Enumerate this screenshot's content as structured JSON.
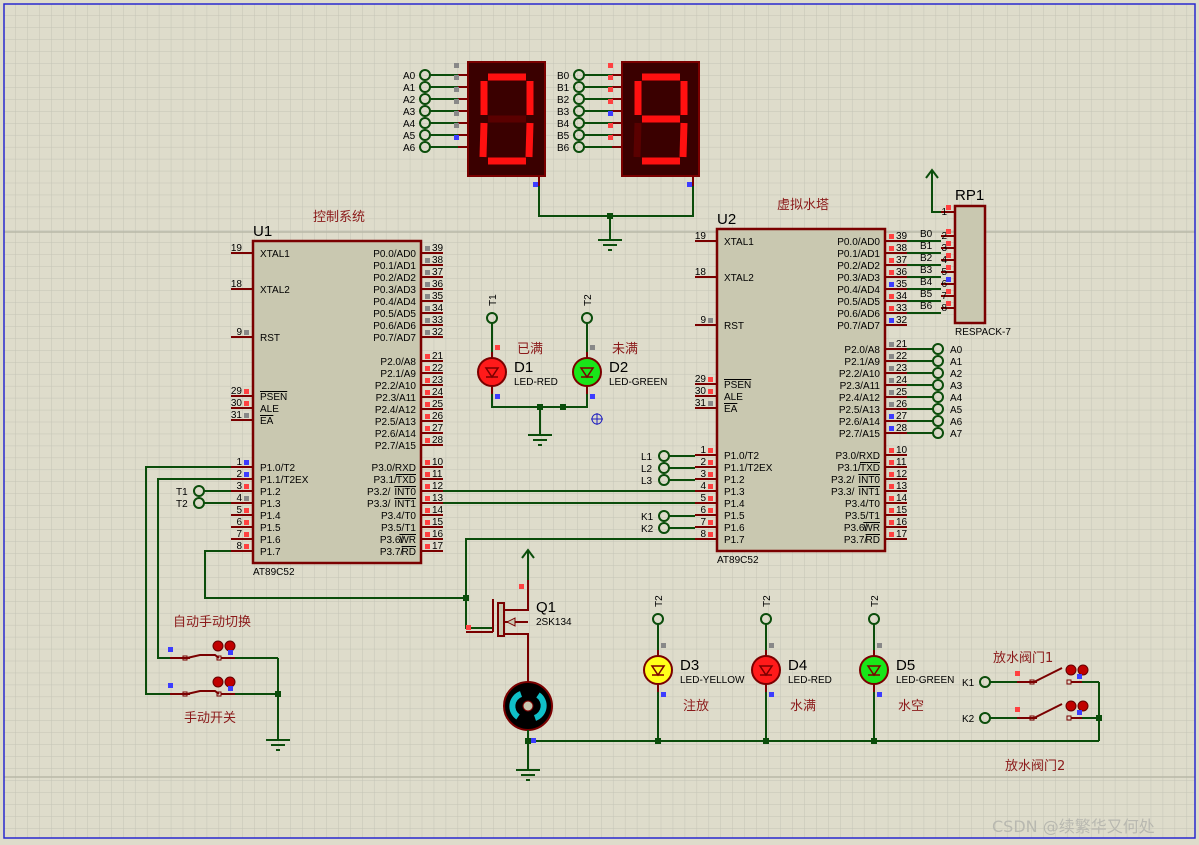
{
  "colors": {
    "wire": "#0b4d0b",
    "component": "#7a0000",
    "chip_fill": "#c9c8b0",
    "high": "#ff4040",
    "low": "#3c3cff",
    "float": "#888888",
    "label_cn": "#8b1a1a",
    "seg_on": "#ff1010",
    "seg_off": "#5a0000",
    "display_bg": "#3a0000"
  },
  "u1": {
    "ref": "U1",
    "title": "控制系统",
    "part": "AT89C52",
    "left": [
      {
        "n": "19",
        "name": "XTAL1"
      },
      {
        "n": "18",
        "name": "XTAL2"
      },
      {
        "n": "9",
        "name": "RST",
        "s": "Z"
      },
      {
        "n": "29",
        "bar": "PSEN",
        "s": "H"
      },
      {
        "n": "30",
        "name": "ALE",
        "s": "H"
      },
      {
        "n": "31",
        "bar": "EA",
        "s": "Z"
      },
      {
        "n": "1",
        "name": "P1.0/T2",
        "s": "L"
      },
      {
        "n": "2",
        "name": "P1.1/T2EX",
        "s": "L"
      },
      {
        "n": "3",
        "name": "P1.2",
        "s": "H"
      },
      {
        "n": "4",
        "name": "P1.3",
        "s": "Z"
      },
      {
        "n": "5",
        "name": "P1.4",
        "s": "H"
      },
      {
        "n": "6",
        "name": "P1.5",
        "s": "H"
      },
      {
        "n": "7",
        "name": "P1.6",
        "s": "H"
      },
      {
        "n": "8",
        "name": "P1.7",
        "s": "H"
      }
    ],
    "right": [
      {
        "n": "39",
        "name": "P0.0/AD0",
        "s": "Z"
      },
      {
        "n": "38",
        "name": "P0.1/AD1",
        "s": "Z"
      },
      {
        "n": "37",
        "name": "P0.2/AD2",
        "s": "Z"
      },
      {
        "n": "36",
        "name": "P0.3/AD3",
        "s": "Z"
      },
      {
        "n": "35",
        "name": "P0.4/AD4",
        "s": "Z"
      },
      {
        "n": "34",
        "name": "P0.5/AD5",
        "s": "Z"
      },
      {
        "n": "33",
        "name": "P0.6/AD6",
        "s": "Z"
      },
      {
        "n": "32",
        "name": "P0.7/AD7",
        "s": "Z"
      },
      {
        "n": "21",
        "name": "P2.0/A8",
        "s": "H"
      },
      {
        "n": "22",
        "name": "P2.1/A9",
        "s": "H"
      },
      {
        "n": "23",
        "name": "P2.2/A10",
        "s": "H"
      },
      {
        "n": "24",
        "name": "P2.3/A11",
        "s": "H"
      },
      {
        "n": "25",
        "name": "P2.4/A12",
        "s": "H"
      },
      {
        "n": "26",
        "name": "P2.5/A13",
        "s": "H"
      },
      {
        "n": "27",
        "name": "P2.6/A14",
        "s": "H"
      },
      {
        "n": "28",
        "name": "P2.7/A15",
        "s": "H"
      },
      {
        "n": "10",
        "name": "P3.0/RXD",
        "s": "H"
      },
      {
        "n": "11",
        "name": "P3.1/",
        "bar": "TXD",
        "s": "H"
      },
      {
        "n": "12",
        "name": "P3.2/",
        "bar": "INT0",
        "s": "H"
      },
      {
        "n": "13",
        "name": "P3.3/",
        "bar": "INT1",
        "s": "H"
      },
      {
        "n": "14",
        "name": "P3.4/T0",
        "s": "H"
      },
      {
        "n": "15",
        "name": "P3.5/T1",
        "s": "H"
      },
      {
        "n": "16",
        "name": "P3.6/",
        "bar": "WR",
        "s": "H"
      },
      {
        "n": "17",
        "name": "P3.7/",
        "bar": "RD",
        "s": "H"
      }
    ]
  },
  "u2": {
    "ref": "U2",
    "title": "虚拟水塔",
    "part": "AT89C52",
    "left": [
      {
        "n": "19",
        "name": "XTAL1"
      },
      {
        "n": "18",
        "name": "XTAL2"
      },
      {
        "n": "9",
        "name": "RST",
        "s": "Z"
      },
      {
        "n": "29",
        "bar": "PSEN",
        "s": "H"
      },
      {
        "n": "30",
        "name": "ALE",
        "s": "H"
      },
      {
        "n": "31",
        "bar": "EA",
        "s": "Z"
      },
      {
        "n": "1",
        "name": "P1.0/T2",
        "s": "H"
      },
      {
        "n": "2",
        "name": "P1.1/T2EX",
        "s": "H"
      },
      {
        "n": "3",
        "name": "P1.2",
        "s": "H"
      },
      {
        "n": "4",
        "name": "P1.3",
        "s": "H"
      },
      {
        "n": "5",
        "name": "P1.4",
        "s": "H"
      },
      {
        "n": "6",
        "name": "P1.5",
        "s": "H"
      },
      {
        "n": "7",
        "name": "P1.6",
        "s": "H"
      },
      {
        "n": "8",
        "name": "P1.7",
        "s": "H"
      }
    ],
    "right": [
      {
        "n": "39",
        "name": "P0.0/AD0",
        "s": "H"
      },
      {
        "n": "38",
        "name": "P0.1/AD1",
        "s": "H"
      },
      {
        "n": "37",
        "name": "P0.2/AD2",
        "s": "H"
      },
      {
        "n": "36",
        "name": "P0.3/AD3",
        "s": "H"
      },
      {
        "n": "35",
        "name": "P0.4/AD4",
        "s": "L"
      },
      {
        "n": "34",
        "name": "P0.5/AD5",
        "s": "H"
      },
      {
        "n": "33",
        "name": "P0.6/AD6",
        "s": "H"
      },
      {
        "n": "32",
        "name": "P0.7/AD7",
        "s": "L"
      },
      {
        "n": "21",
        "name": "P2.0/A8",
        "s": "Z"
      },
      {
        "n": "22",
        "name": "P2.1/A9",
        "s": "Z"
      },
      {
        "n": "23",
        "name": "P2.2/A10",
        "s": "Z"
      },
      {
        "n": "24",
        "name": "P2.3/A11",
        "s": "Z"
      },
      {
        "n": "25",
        "name": "P2.4/A12",
        "s": "Z"
      },
      {
        "n": "26",
        "name": "P2.5/A13",
        "s": "Z"
      },
      {
        "n": "27",
        "name": "P2.6/A14",
        "s": "L"
      },
      {
        "n": "28",
        "name": "P2.7/A15",
        "s": "L"
      },
      {
        "n": "10",
        "name": "P3.0/RXD",
        "s": "H"
      },
      {
        "n": "11",
        "name": "P3.1/",
        "bar": "TXD",
        "s": "H"
      },
      {
        "n": "12",
        "name": "P3.2/",
        "bar": "INT0",
        "s": "H"
      },
      {
        "n": "13",
        "name": "P3.3/",
        "bar": "INT1",
        "s": "H"
      },
      {
        "n": "14",
        "name": "P3.4/T0",
        "s": "H"
      },
      {
        "n": "15",
        "name": "P3.5/T1",
        "s": "H"
      },
      {
        "n": "16",
        "name": "P3.6/",
        "bar": "WR",
        "s": "H"
      },
      {
        "n": "17",
        "name": "P3.7/",
        "bar": "RD",
        "s": "H"
      }
    ]
  },
  "display_a": {
    "labels": [
      "A0",
      "A1",
      "A2",
      "A3",
      "A4",
      "A5",
      "A6"
    ],
    "states": [
      "Z",
      "Z",
      "Z",
      "Z",
      "Z",
      "Z",
      "L"
    ],
    "digit": "0",
    "segments": [
      1,
      1,
      1,
      1,
      1,
      1,
      0
    ]
  },
  "display_b": {
    "labels": [
      "B0",
      "B1",
      "B2",
      "B3",
      "B4",
      "B5",
      "B6"
    ],
    "states": [
      "H",
      "H",
      "H",
      "H",
      "L",
      "H",
      "H"
    ],
    "digit": "9",
    "segments": [
      1,
      1,
      1,
      1,
      0,
      1,
      1
    ]
  },
  "rp1": {
    "ref": "RP1",
    "part": "RESPACK-7",
    "pins": [
      "1",
      "2",
      "3",
      "4",
      "5",
      "6",
      "7",
      "8"
    ],
    "bus_labels": [
      "B0",
      "B1",
      "B2",
      "B3",
      "B4",
      "B5",
      "B6"
    ]
  },
  "u2_port2_terminals": [
    "A0",
    "A1",
    "A2",
    "A3",
    "A4",
    "A5",
    "A6",
    "A7"
  ],
  "u2_p1_terminals": [
    "L1",
    "L2",
    "L3"
  ],
  "u2_k_terminals": [
    "K1",
    "K2"
  ],
  "u1_t_terminals": [
    "T1",
    "T2"
  ],
  "leds": [
    {
      "ref": "D1",
      "part": "LED-RED",
      "label": "已满",
      "term": "T1",
      "color": "#ff1a1a"
    },
    {
      "ref": "D2",
      "part": "LED-GREEN",
      "label": "未满",
      "term": "T2",
      "color": "#19e619"
    },
    {
      "ref": "D3",
      "part": "LED-YELLOW",
      "label": "注放",
      "term": "T2",
      "color": "#ffff1a"
    },
    {
      "ref": "D4",
      "part": "LED-RED",
      "label": "水满",
      "term": "T2",
      "color": "#ff1a1a"
    },
    {
      "ref": "D5",
      "part": "LED-GREEN",
      "label": "水空",
      "term": "T2",
      "color": "#19e619"
    }
  ],
  "q1": {
    "ref": "Q1",
    "part": "2SK134"
  },
  "switches": {
    "auto_manual": "自动手动切换",
    "manual": "手动开关",
    "valve1": "放水阀门1",
    "valve2": "放水阀门2",
    "valve_terms": [
      "K1",
      "K2"
    ]
  },
  "watermark": "CSDN @续繁华又何处"
}
